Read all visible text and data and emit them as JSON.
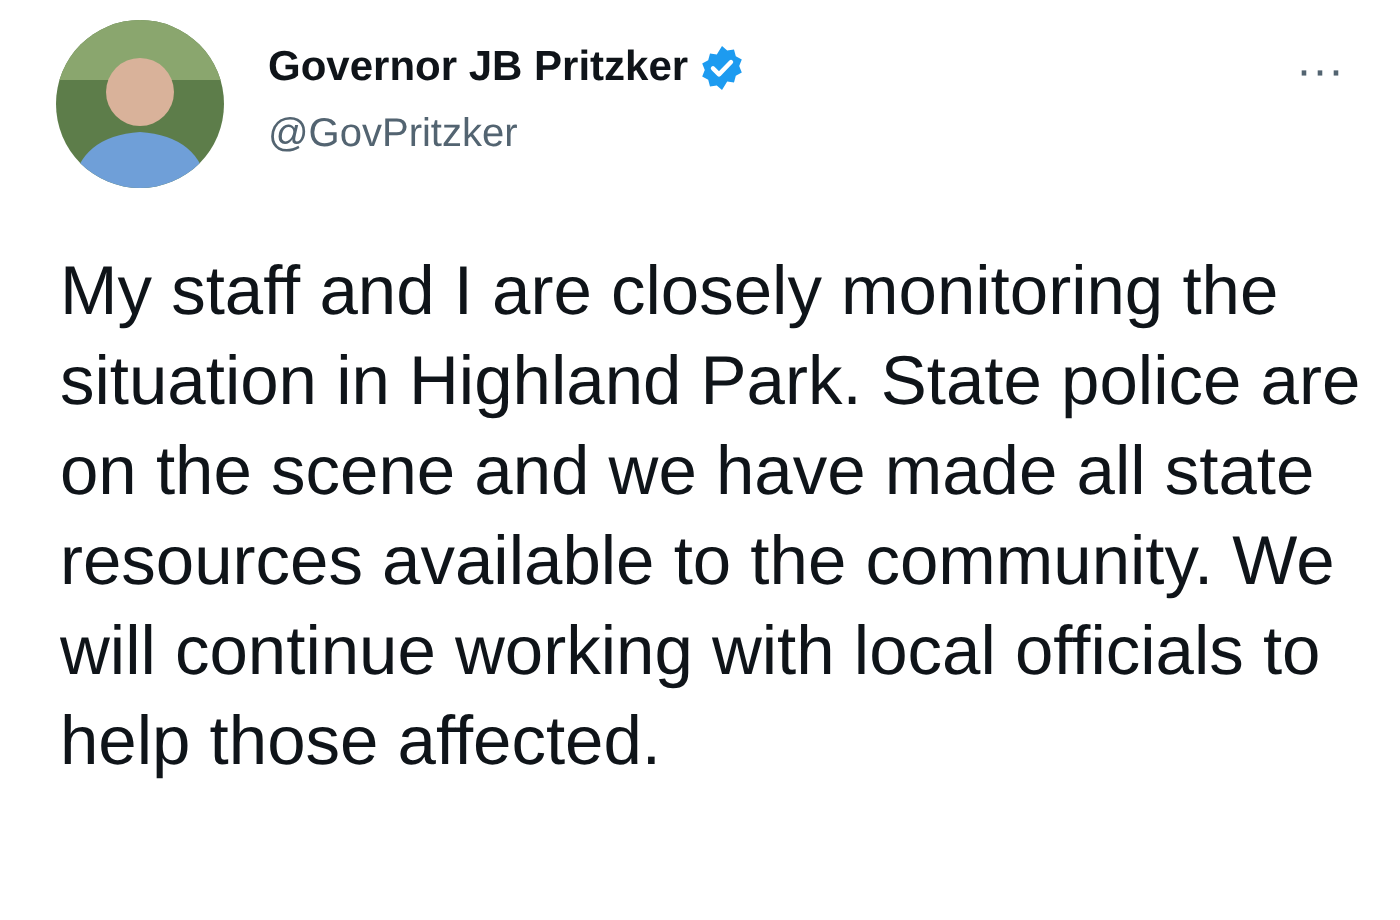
{
  "author": {
    "name": "Governor JB Pritzker",
    "verified": true,
    "handle": "@GovPritzker"
  },
  "more_menu": "···",
  "text": "My staff and I are closely monitoring the situation in Highland Park. State police are on the scene and we have made all state resources available to the community. We will continue working with local officials to help those affected."
}
